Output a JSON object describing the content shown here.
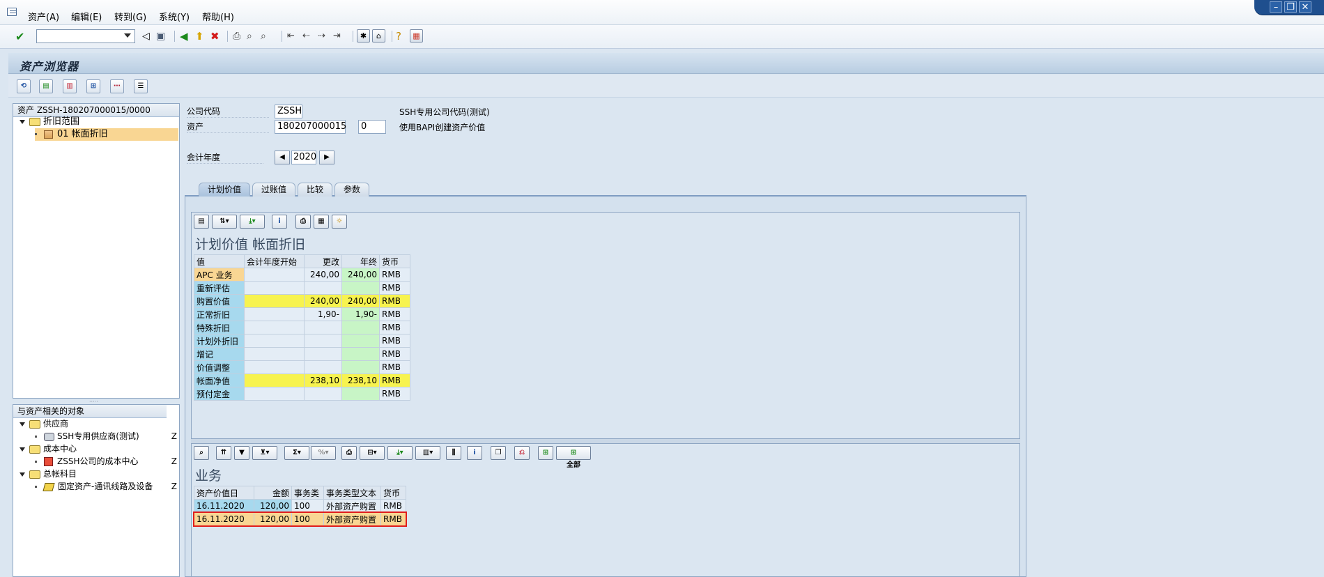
{
  "menu": [
    "资产(A)",
    "编辑(E)",
    "转到(G)",
    "系统(Y)",
    "帮助(H)"
  ],
  "page_title": "资产浏览器",
  "tree": {
    "header": "资产 ZSSH-180207000015/0000",
    "items": [
      {
        "label": "折旧范围"
      },
      {
        "label": "01  帐面折旧"
      }
    ]
  },
  "related": {
    "header": "与资产相关的对象",
    "items": [
      {
        "label": "供应商",
        "suffix": ""
      },
      {
        "label": "SSH专用供应商(测试)",
        "suffix": "Z"
      },
      {
        "label": "成本中心",
        "suffix": ""
      },
      {
        "label": "ZSSH公司的成本中心",
        "suffix": "Z"
      },
      {
        "label": "总帐科目",
        "suffix": ""
      },
      {
        "label": "固定资产-通讯线路及设备",
        "suffix": "Z"
      }
    ]
  },
  "form": {
    "company_code_label": "公司代码",
    "company_code_value": "ZSSH",
    "company_code_desc": "SSH专用公司代码(测试)",
    "asset_label": "资产",
    "asset_value": "180207000015",
    "asset_sub": "0",
    "asset_desc": "使用BAPI创建资产价值",
    "fiscal_year_label": "会计年度",
    "fiscal_year_value": "2020"
  },
  "tabs": [
    "计划价值",
    "过账值",
    "比较",
    "参数"
  ],
  "values_grid": {
    "title": "计划价值 帐面折旧",
    "columns": [
      "值",
      "会计年度开始",
      "更改",
      "年终",
      "货币"
    ],
    "rows": [
      {
        "name": "APC 业务",
        "start": "",
        "change": "240,00",
        "year_end": "240,00",
        "currency": "RMB",
        "style": "apc"
      },
      {
        "name": "重新评估",
        "start": "",
        "change": "",
        "year_end": "",
        "currency": "RMB",
        "style": "normal"
      },
      {
        "name": "购置价值",
        "start": "",
        "change": "240,00",
        "year_end": "240,00",
        "currency": "RMB",
        "style": "yellow"
      },
      {
        "name": "正常折旧",
        "start": "",
        "change": "1,90-",
        "year_end": "1,90-",
        "currency": "RMB",
        "style": "normal"
      },
      {
        "name": "特殊折旧",
        "start": "",
        "change": "",
        "year_end": "",
        "currency": "RMB",
        "style": "normal"
      },
      {
        "name": "计划外折旧",
        "start": "",
        "change": "",
        "year_end": "",
        "currency": "RMB",
        "style": "normal"
      },
      {
        "name": "增记",
        "start": "",
        "change": "",
        "year_end": "",
        "currency": "RMB",
        "style": "normal"
      },
      {
        "name": "价值调整",
        "start": "",
        "change": "",
        "year_end": "",
        "currency": "RMB",
        "style": "normal"
      },
      {
        "name": "帐面净值",
        "start": "",
        "change": "238,10",
        "year_end": "238,10",
        "currency": "RMB",
        "style": "yellow"
      },
      {
        "name": "预付定金",
        "start": "",
        "change": "",
        "year_end": "",
        "currency": "RMB",
        "style": "normal"
      }
    ]
  },
  "trans_grid": {
    "title": "业务",
    "all_label": "全部",
    "columns": [
      "资产价值日",
      "金额",
      "事务类",
      "事务类型文本",
      "货币"
    ],
    "rows": [
      {
        "date": "16.11.2020",
        "amount": "120,00",
        "type": "100",
        "text": "外部资产购置",
        "currency": "RMB"
      },
      {
        "date": "16.11.2020",
        "amount": "120,00",
        "type": "100",
        "text": "外部资产购置",
        "currency": "RMB"
      }
    ]
  },
  "colors": {
    "accent": "#1f4f8e",
    "highlight": "#f9d693",
    "yellow": "#f7f34f",
    "green": "#c8f5c6",
    "blue": "#a7d9ee",
    "red_box": "#e01c1c"
  },
  "icons": [
    "check-icon",
    "back-icon",
    "save-icon",
    "green-arrow-icon",
    "exit-icon",
    "cancel-icon",
    "print-icon",
    "find-icon",
    "help-icon",
    "refresh-icon"
  ]
}
